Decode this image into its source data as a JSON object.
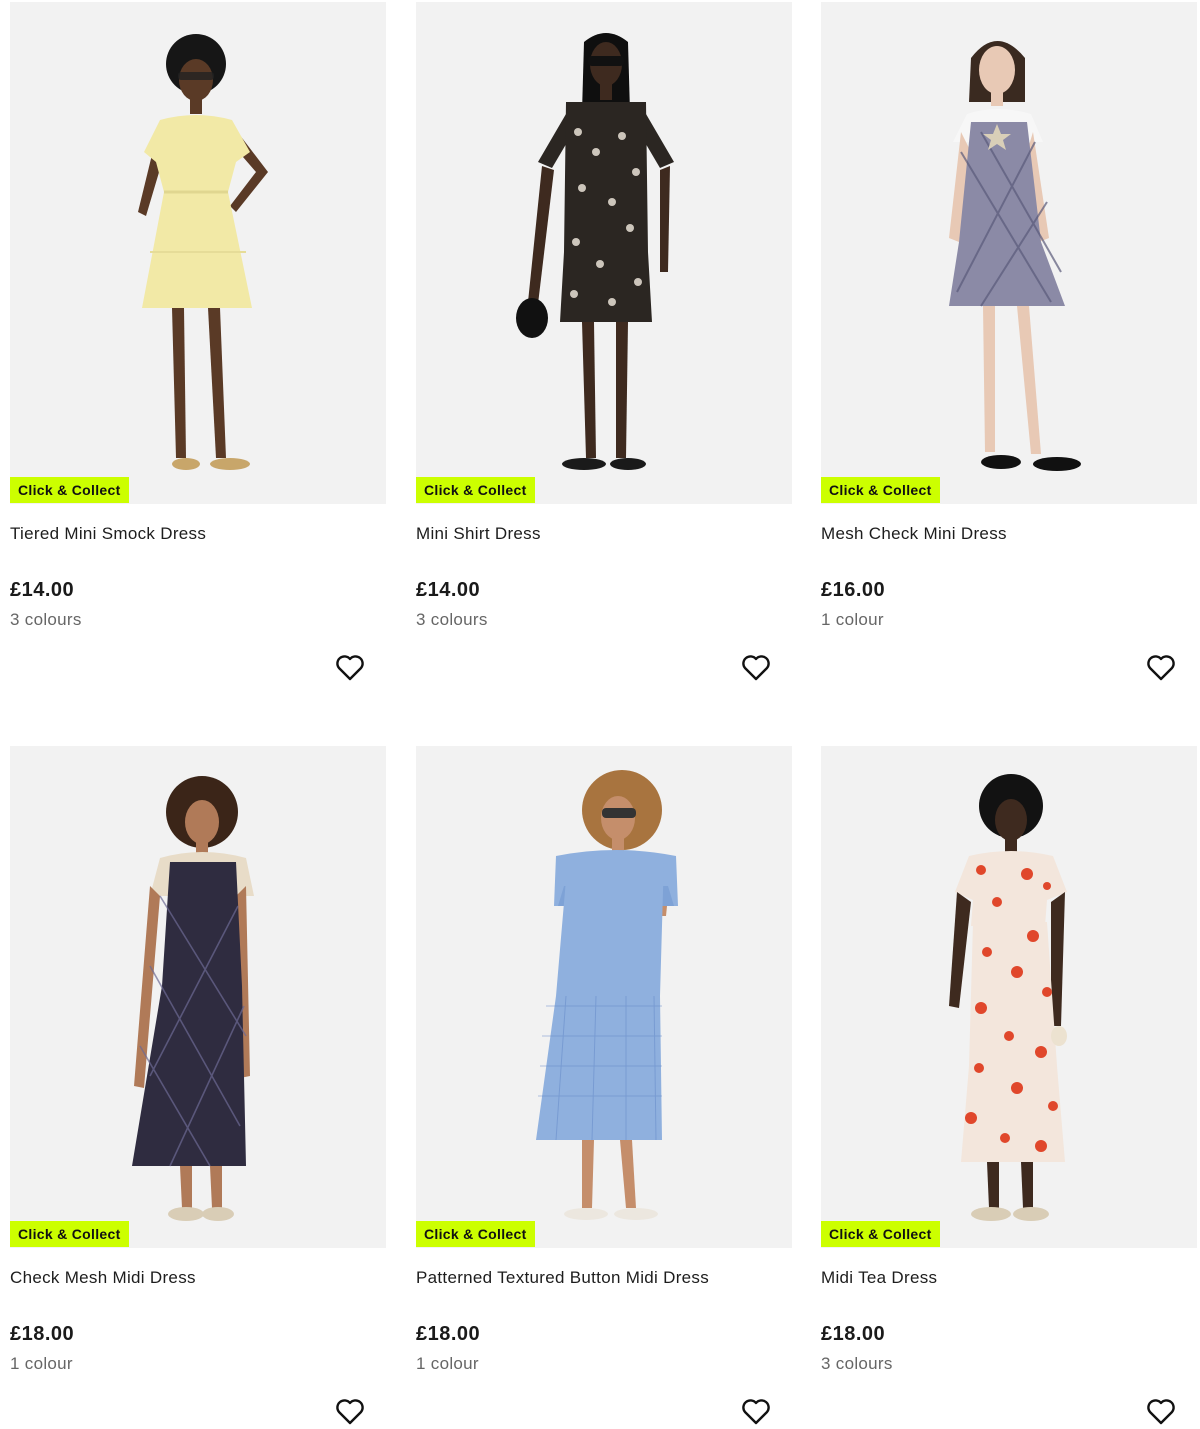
{
  "products": [
    {
      "badge": "Click & Collect",
      "title": "Tiered Mini Smock Dress",
      "price": "£14.00",
      "colours": "3 colours",
      "wishlist_icon": "heart-outline-icon",
      "dress_color": "#f2e9a6",
      "skin": "#5a3a26",
      "hair": "#161616"
    },
    {
      "badge": "Click & Collect",
      "title": "Mini Shirt Dress",
      "price": "£14.00",
      "colours": "3 colours",
      "wishlist_icon": "heart-outline-icon",
      "dress_color": "#2b2622",
      "skin": "#3e2a1f",
      "hair": "#0f0f0f"
    },
    {
      "badge": "Click & Collect",
      "title": "Mesh Check Mini Dress",
      "price": "£16.00",
      "colours": "1 colour",
      "wishlist_icon": "heart-outline-icon",
      "dress_color": "#8b8aa6",
      "skin": "#e8c9b5",
      "hair": "#3a2a20"
    },
    {
      "badge": "Click & Collect",
      "title": "Check Mesh Midi Dress",
      "price": "£18.00",
      "colours": "1 colour",
      "wishlist_icon": "heart-outline-icon",
      "dress_color": "#2f2c40",
      "skin": "#b07a58",
      "hair": "#3b2518"
    },
    {
      "badge": "Click & Collect",
      "title": "Patterned Textured Button Midi Dress",
      "price": "£18.00",
      "colours": "1 colour",
      "wishlist_icon": "heart-outline-icon",
      "dress_color": "#8fb0de",
      "skin": "#c58e6b",
      "hair": "#a8743f"
    },
    {
      "badge": "Click & Collect",
      "title": "Midi Tea Dress",
      "price": "£18.00",
      "colours": "3 colours",
      "wishlist_icon": "heart-outline-icon",
      "dress_color": "#f3e6dc",
      "skin": "#3e2a1f",
      "hair": "#121212"
    }
  ],
  "theme": {
    "badge_color": "#ccff00",
    "image_bg": "#f2f2f2"
  }
}
